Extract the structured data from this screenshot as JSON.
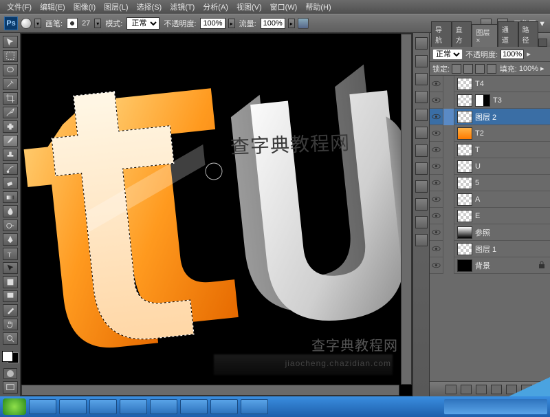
{
  "menu": {
    "file": "文件(F)",
    "edit": "编辑(E)",
    "image": "图像(I)",
    "layer": "图层(L)",
    "select": "选择(S)",
    "filter": "滤镜(T)",
    "analysis": "分析(A)",
    "view": "视图(V)",
    "window": "窗口(W)",
    "help": "帮助(H)"
  },
  "options": {
    "brush_lbl": "画笔:",
    "brush_size": "27",
    "mode_lbl": "模式:",
    "mode_val": "正常",
    "opacity_lbl": "不透明度:",
    "opacity_val": "100%",
    "flow_lbl": "流量:",
    "flow_val": "100%"
  },
  "workspace": {
    "label": "工作区 ▼"
  },
  "panel": {
    "tabs": {
      "nav": "导航",
      "histo": "直方",
      "layers": "图层 ×",
      "channels": "通道",
      "paths": "路径"
    },
    "blend_mode": "正常",
    "opacity_lbl": "不透明度:",
    "opacity_val": "100%",
    "lock_lbl": "锁定:",
    "fill_lbl": "填充:",
    "fill_val": "100%"
  },
  "layers": [
    {
      "name": "T4",
      "thumb": "chk"
    },
    {
      "name": "T3",
      "thumb": "chk",
      "mask": true
    },
    {
      "name": "图层 2",
      "thumb": "chk",
      "selected": true
    },
    {
      "name": "T2",
      "thumb": "orng"
    },
    {
      "name": "T",
      "thumb": "chk"
    },
    {
      "name": "U",
      "thumb": "chk"
    },
    {
      "name": "5",
      "thumb": "chk"
    },
    {
      "name": "A",
      "thumb": "chk"
    },
    {
      "name": "E",
      "thumb": "chk"
    },
    {
      "name": "参照",
      "thumb": "grd"
    },
    {
      "name": "图层 1",
      "thumb": "chk"
    },
    {
      "name": "背景",
      "thumb": "blk",
      "locked": true
    }
  ],
  "watermark": {
    "main": "查字典教程网",
    "sub": "查字典教程网",
    "url": "jiaocheng.chazidian.com"
  },
  "taskbar": {
    "time": ""
  }
}
